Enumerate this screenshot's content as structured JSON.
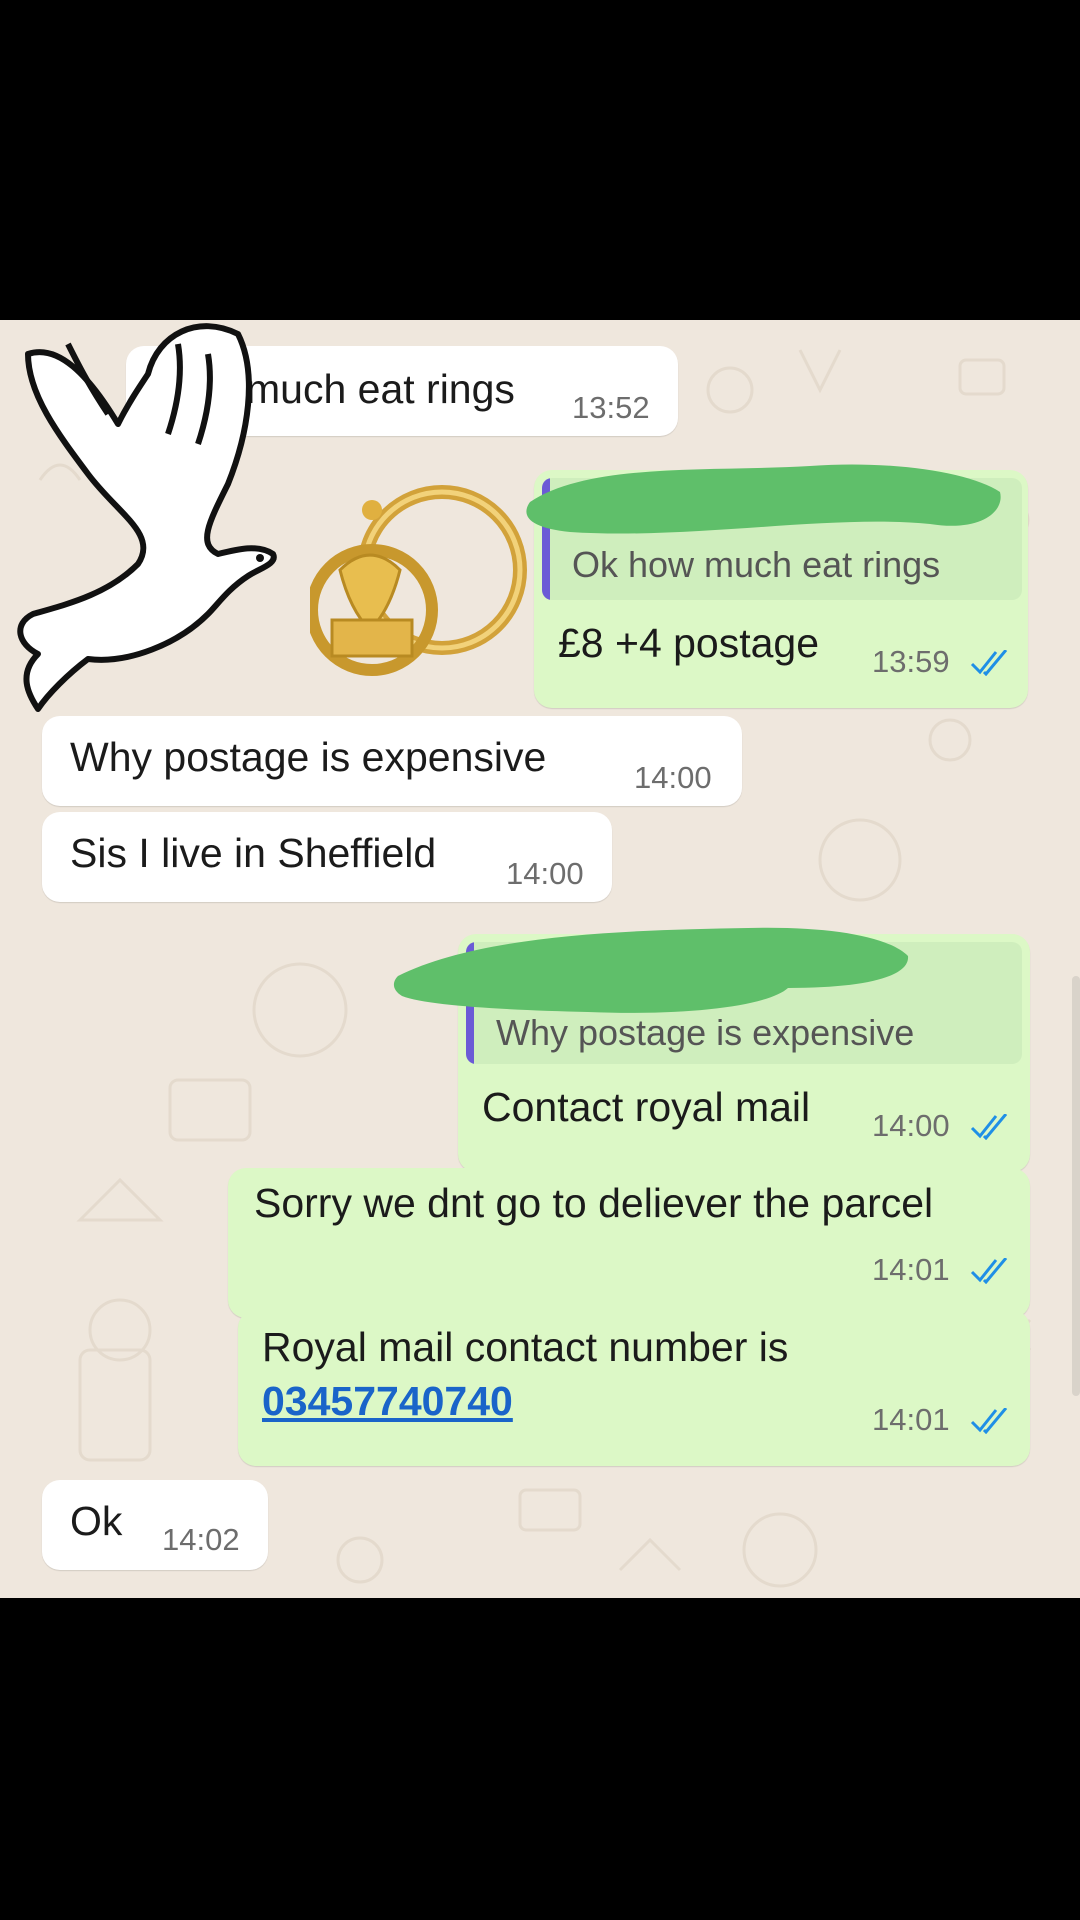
{
  "messages": [
    {
      "text": "much eat rings",
      "time": "13:52"
    },
    {
      "quote": "Ok how much eat rings",
      "text": "£8 +4 postage",
      "time": "13:59"
    },
    {
      "text": "Why postage is expensive",
      "time": "14:00"
    },
    {
      "text": "Sis I live in Sheffield",
      "time": "14:00"
    },
    {
      "quote": "Why postage is expensive",
      "text": "Contact royal mail",
      "time": "14:00"
    },
    {
      "text": "Sorry we dnt go to deliever the parcel",
      "time": "14:01"
    },
    {
      "text": "Royal mail contact number is",
      "link": "03457740740",
      "time": "14:01"
    },
    {
      "text": "Ok",
      "time": "14:02"
    }
  ],
  "colors": {
    "incoming_bubble": "#ffffff",
    "outgoing_bubble": "#dcf8c6",
    "read_ticks": "#1f8fe6",
    "link": "#1a64c9",
    "redaction": "#5fbf6a"
  },
  "icons": [
    "dove-sticker-icon",
    "earrings-sticker-icon",
    "double-tick-read-icon"
  ]
}
